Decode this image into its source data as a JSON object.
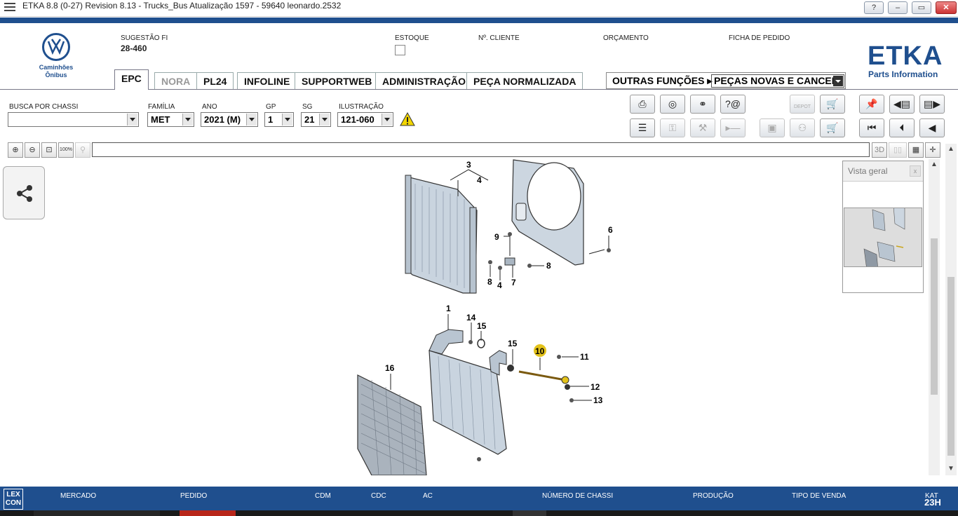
{
  "window": {
    "title": "ETKA 8.8 (0-27) Revision 8.13 - Trucks_Bus Atualização 1597 - 59640 leonardo.2532",
    "buttons": {
      "help": "?",
      "minimize": "–",
      "maximize": "▭",
      "close": "✕"
    }
  },
  "brand": {
    "subtitle_line1": "Caminhões",
    "subtitle_line2": "Ônibus",
    "etka": "ETKA",
    "etka_sub": "Parts Information"
  },
  "header": {
    "sugestao_label": "SUGESTÃO FI",
    "sugestao_value": "28-460",
    "estoque_label": "ESTOQUE",
    "cliente_label": "Nº. CLIENTE",
    "orcamento_label": "ORÇAMENTO",
    "ficha_label": "FICHA DE PEDIDO"
  },
  "tabs": [
    {
      "label": "EPC",
      "active": true
    },
    {
      "label": "NORA",
      "disabled": true
    },
    {
      "label": "PL24"
    },
    {
      "label": "INFOLINE"
    },
    {
      "label": "SUPPORTWEB"
    },
    {
      "label": "ADMINISTRAÇÃO"
    },
    {
      "label": "PEÇA NORMALIZADA"
    }
  ],
  "outras": {
    "label": "OUTRAS FUNÇÕES ▸",
    "selected": "PEÇAS NOVAS E CANCEL."
  },
  "search": {
    "chassi_label": "BUSCA POR CHASSI",
    "chassi_value": "",
    "familia_label": "FAMÍLIA",
    "familia_value": "MET",
    "ano_label": "ANO",
    "ano_value": "2021 (M)",
    "gp_label": "GP",
    "gp_value": "1",
    "sg_label": "SG",
    "sg_value": "21",
    "ilustracao_label": "ILUSTRAÇÃO",
    "ilustracao_value": "121-060"
  },
  "toolbar": {
    "depot_label": "DEPOT",
    "zoom_100_label": "100%",
    "view_3d_label": "3D"
  },
  "drawing": {
    "labels": [
      "3",
      "4",
      "6",
      "9",
      "8",
      "8",
      "4",
      "7",
      "1",
      "14",
      "15",
      "15",
      "10",
      "11",
      "12",
      "13",
      "16"
    ]
  },
  "vista": {
    "title": "Vista geral",
    "close": "x"
  },
  "footer": {
    "logo_line1": "LEX",
    "logo_line2": "CON",
    "mercado": "MERCADO",
    "pedido": "PEDIDO",
    "cdm": "CDM",
    "cdc": "CDC",
    "ac": "AC",
    "numero_chassi": "NÚMERO DE CHASSI",
    "producao": "PRODUÇÃO",
    "tipo_venda": "TIPO DE VENDA",
    "kat_label": "KAT",
    "kat_value": "23H"
  },
  "colors": {
    "brand": "#1f4f8e",
    "highlight": "#e3c21a"
  }
}
